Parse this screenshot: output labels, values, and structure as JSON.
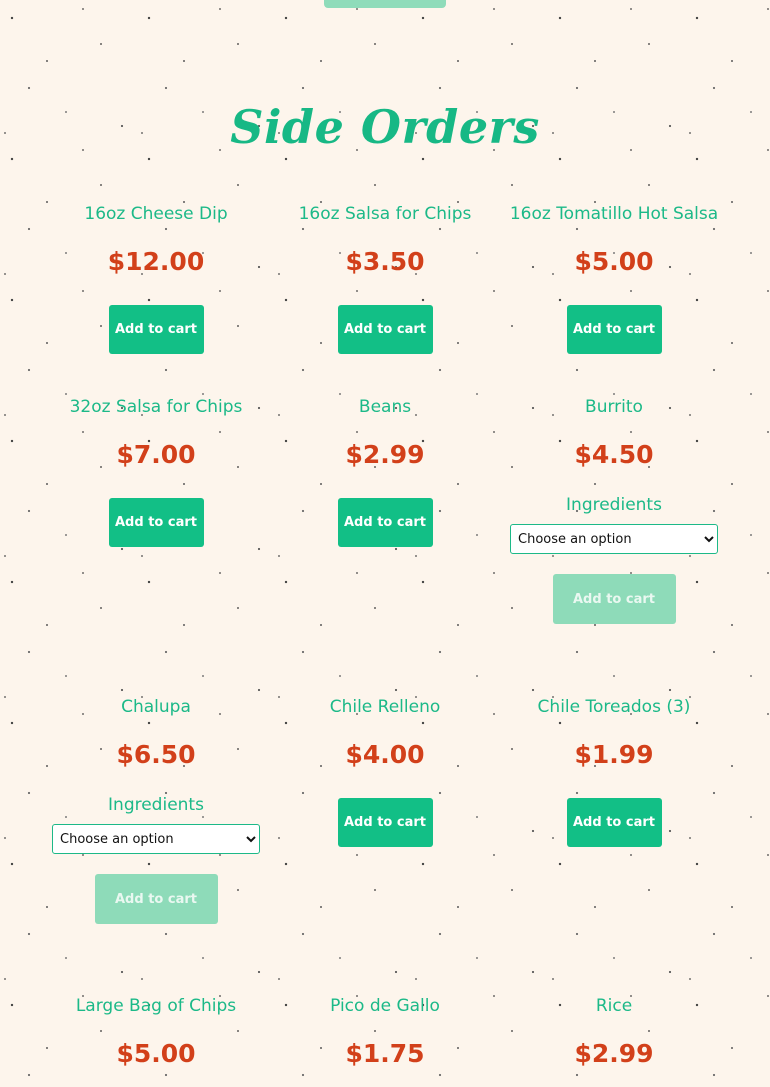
{
  "section": {
    "title": "Side Orders"
  },
  "products": [
    {
      "name": "16oz Cheese Dip",
      "price": "$12.00",
      "button": "Add to cart"
    },
    {
      "name": "16oz Salsa for Chips",
      "price": "$3.50",
      "button": "Add to cart"
    },
    {
      "name": "16oz Tomatillo Hot Salsa",
      "price": "$5.00",
      "button": "Add to cart"
    },
    {
      "name": "32oz Salsa for Chips",
      "price": "$7.00",
      "button": "Add to cart"
    },
    {
      "name": "Beans",
      "price": "$2.99",
      "button": "Add to cart"
    },
    {
      "name": "Burrito",
      "price": "$4.50",
      "ingredients_label": "Ingredients",
      "select_value": "Choose an option",
      "button": "Add to cart"
    },
    {
      "name": "Chalupa",
      "price": "$6.50",
      "ingredients_label": "Ingredients",
      "select_value": "Choose an option",
      "button": "Add to cart"
    },
    {
      "name": "Chile Relleno",
      "price": "$4.00",
      "button": "Add to cart"
    },
    {
      "name": "Chile Toreados (3)",
      "price": "$1.99",
      "button": "Add to cart"
    },
    {
      "name": "Large Bag of Chips",
      "price": "$5.00"
    },
    {
      "name": "Pico de Gallo",
      "price": "$1.75"
    },
    {
      "name": "Rice",
      "price": "$2.99"
    }
  ],
  "colors": {
    "accent": "#12bf86",
    "accent_disabled": "#8edbb9",
    "price": "#d2401a",
    "background": "#fdf5ec"
  }
}
